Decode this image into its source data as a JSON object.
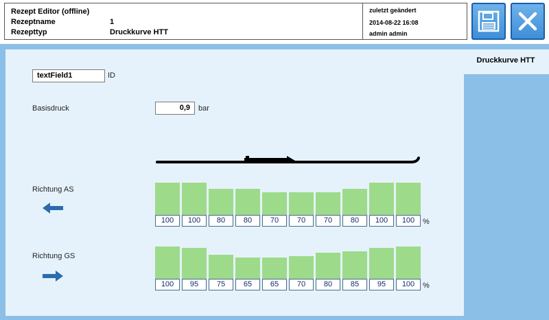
{
  "header": {
    "title": "Rezept Editor (offline)",
    "name_label": "Rezeptname",
    "name_value": "1",
    "type_label": "Rezepttyp",
    "type_value": "Druckkurve HTT",
    "changed_label": "zuletzt geändert",
    "changed_date": "2014-08-22 16:08",
    "changed_by": "admin admin"
  },
  "toolbar": {
    "save_icon": "floppy-disk-icon",
    "close_icon": "close-x-icon"
  },
  "tab": {
    "label": "Druckkurve HTT"
  },
  "form": {
    "id_value": "textField1",
    "id_label": "ID",
    "basisdruck_label": "Basisdruck",
    "basisdruck_value": "0,9",
    "basisdruck_unit": "bar"
  },
  "richtung_as": {
    "label": "Richtung AS",
    "unit": "%",
    "values": [
      100,
      100,
      80,
      80,
      70,
      70,
      70,
      80,
      100,
      100
    ]
  },
  "richtung_gs": {
    "label": "Richtung GS",
    "unit": "%",
    "values": [
      100,
      95,
      75,
      65,
      65,
      70,
      80,
      85,
      95,
      100
    ]
  },
  "colors": {
    "accent": "#3f8ed8",
    "bar": "#9ddb8b",
    "panel": "#e6f2fb",
    "band": "#8bbfe8"
  }
}
